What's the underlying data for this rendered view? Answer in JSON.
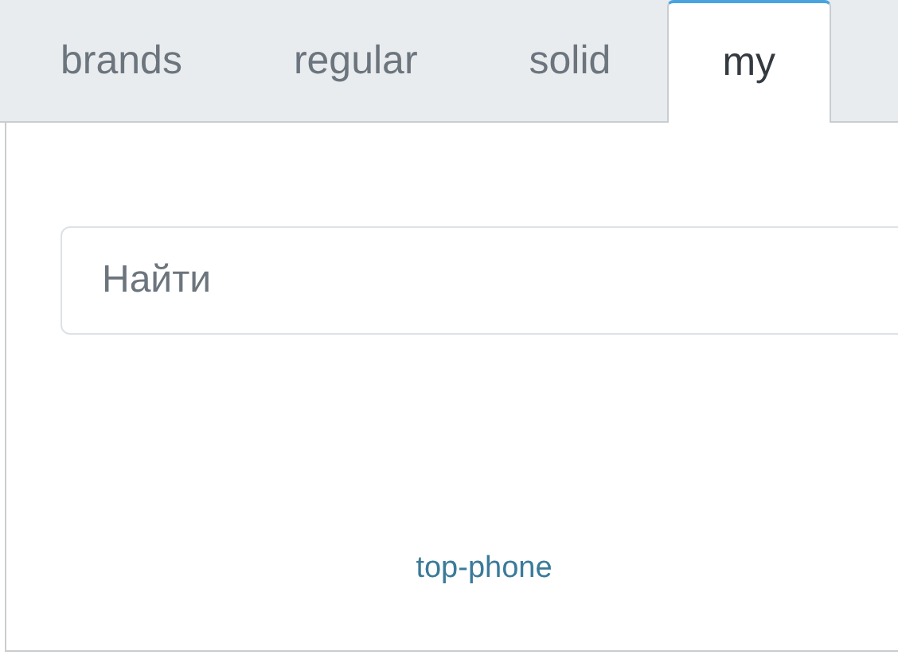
{
  "tabs": [
    {
      "label": "brands",
      "selected": false
    },
    {
      "label": "regular",
      "selected": false
    },
    {
      "label": "solid",
      "selected": false
    },
    {
      "label": "my",
      "selected": true
    }
  ],
  "search": {
    "placeholder": "Найти"
  },
  "link": "top-phone"
}
